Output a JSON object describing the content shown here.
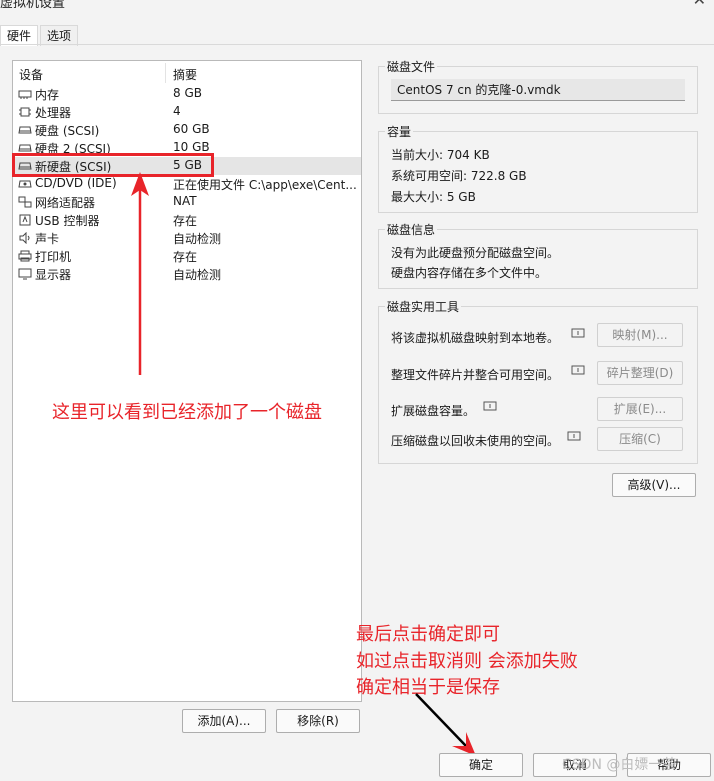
{
  "window": {
    "title": "虚拟机设置",
    "close_glyph": "✕"
  },
  "tabs": [
    {
      "label": "硬件"
    },
    {
      "label": "选项"
    }
  ],
  "device_list": {
    "col_device": "设备",
    "col_summary": "摘要",
    "rows": [
      {
        "device": "内存",
        "summary": "8 GB",
        "icon": "memory-icon"
      },
      {
        "device": "处理器",
        "summary": "4",
        "icon": "cpu-icon"
      },
      {
        "device": "硬盘 (SCSI)",
        "summary": "60 GB",
        "icon": "disk-icon"
      },
      {
        "device": "硬盘 2 (SCSI)",
        "summary": "10 GB",
        "icon": "disk-icon"
      },
      {
        "device": "新硬盘 (SCSI)",
        "summary": "5 GB",
        "icon": "disk-icon"
      },
      {
        "device": "CD/DVD (IDE)",
        "summary": "正在使用文件 C:\\app\\exe\\Cent...",
        "icon": "cdrom-icon"
      },
      {
        "device": "网络适配器",
        "summary": "NAT",
        "icon": "network-icon"
      },
      {
        "device": "USB 控制器",
        "summary": "存在",
        "icon": "usb-icon"
      },
      {
        "device": "声卡",
        "summary": "自动检测",
        "icon": "speaker-icon"
      },
      {
        "device": "打印机",
        "summary": "存在",
        "icon": "printer-icon"
      },
      {
        "device": "显示器",
        "summary": "自动检测",
        "icon": "monitor-icon"
      }
    ]
  },
  "buttons": {
    "add": "添加(A)...",
    "remove": "移除(R)",
    "advanced": "高级(V)...",
    "ok": "确定",
    "cancel": "取消",
    "help": "帮助"
  },
  "disk_file": {
    "title": "磁盘文件",
    "value": "CentOS 7 cn 的克隆-0.vmdk"
  },
  "capacity": {
    "title": "容量",
    "current": "当前大小: 704 KB",
    "available": "系统可用空间: 722.8 GB",
    "max": "最大大小: 5 GB"
  },
  "disk_info": {
    "title": "磁盘信息",
    "line1": "没有为此硬盘预分配磁盘空间。",
    "line2": "硬盘内容存储在多个文件中。"
  },
  "utilities": {
    "title": "磁盘实用工具",
    "items": [
      {
        "label": "将该虚拟机磁盘映射到本地卷。",
        "button": "映射(M)..."
      },
      {
        "label": "整理文件碎片并整合可用空间。",
        "button": "碎片整理(D)"
      },
      {
        "label": "扩展磁盘容量。",
        "button": "扩展(E)..."
      },
      {
        "label": "压缩磁盘以回收未使用的空间。",
        "button": "压缩(C)"
      }
    ]
  },
  "annotations": {
    "added_disk": "这里可以看到已经添加了一个磁盘",
    "note1": "最后点击确定即可",
    "note2": "如过点击取消则 会添加失败",
    "note3": "确定相当于是保存"
  },
  "watermark": "CSDN @白嫖一茶",
  "colors": {
    "annotation": "#e8242a",
    "selection": "#e5e5e5"
  }
}
